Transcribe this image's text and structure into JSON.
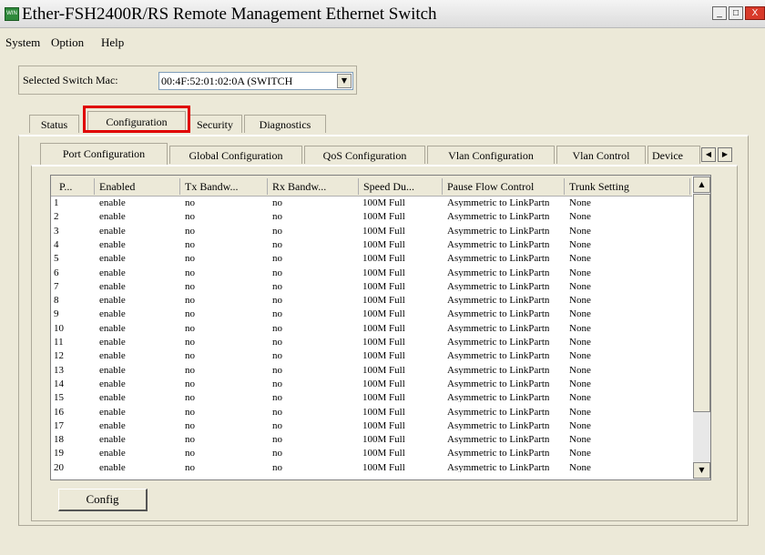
{
  "window": {
    "title": "Ether-FSH2400R/RS Remote Management Ethernet Switch",
    "icon_text": "WIN",
    "minimize": "_",
    "maximize": "□",
    "close": "X"
  },
  "menu": [
    "System",
    "Option",
    "Help"
  ],
  "switch_select": {
    "label": "Selected Switch Mac:",
    "value": "00:4F:52:01:02:0A (SWITCH",
    "arrow": "▼"
  },
  "main_tabs": [
    "Status",
    "Configuration",
    "Security",
    "Diagnostics"
  ],
  "active_main_tab": "Configuration",
  "sub_tabs": [
    "Port Configuration",
    "Global Configuration",
    "QoS Configuration",
    "Vlan Configuration",
    "Vlan Control",
    "Device"
  ],
  "active_sub_tab": "Port Configuration",
  "tab_scroll": {
    "left": "◀",
    "right": "▶"
  },
  "table": {
    "columns": [
      "P...",
      "Enabled",
      "Tx Bandw...",
      "Rx Bandw...",
      "Speed Du...",
      "Pause Flow Control",
      "Trunk Setting"
    ],
    "rows": [
      [
        "1",
        "enable",
        "no",
        "no",
        "100M Full",
        "Asymmetric to LinkPartn",
        "None"
      ],
      [
        "2",
        "enable",
        "no",
        "no",
        "100M Full",
        "Asymmetric to LinkPartn",
        "None"
      ],
      [
        "3",
        "enable",
        "no",
        "no",
        "100M Full",
        "Asymmetric to LinkPartn",
        "None"
      ],
      [
        "4",
        "enable",
        "no",
        "no",
        "100M Full",
        "Asymmetric to LinkPartn",
        "None"
      ],
      [
        "5",
        "enable",
        "no",
        "no",
        "100M Full",
        "Asymmetric to LinkPartn",
        "None"
      ],
      [
        "6",
        "enable",
        "no",
        "no",
        "100M Full",
        "Asymmetric to LinkPartn",
        "None"
      ],
      [
        "7",
        "enable",
        "no",
        "no",
        "100M Full",
        "Asymmetric to LinkPartn",
        "None"
      ],
      [
        "8",
        "enable",
        "no",
        "no",
        "100M Full",
        "Asymmetric to LinkPartn",
        "None"
      ],
      [
        "9",
        "enable",
        "no",
        "no",
        "100M Full",
        "Asymmetric to LinkPartn",
        "None"
      ],
      [
        "10",
        "enable",
        "no",
        "no",
        "100M Full",
        "Asymmetric to LinkPartn",
        "None"
      ],
      [
        "11",
        "enable",
        "no",
        "no",
        "100M Full",
        "Asymmetric to LinkPartn",
        "None"
      ],
      [
        "12",
        "enable",
        "no",
        "no",
        "100M Full",
        "Asymmetric to LinkPartn",
        "None"
      ],
      [
        "13",
        "enable",
        "no",
        "no",
        "100M Full",
        "Asymmetric to LinkPartn",
        "None"
      ],
      [
        "14",
        "enable",
        "no",
        "no",
        "100M Full",
        "Asymmetric to LinkPartn",
        "None"
      ],
      [
        "15",
        "enable",
        "no",
        "no",
        "100M Full",
        "Asymmetric to LinkPartn",
        "None"
      ],
      [
        "16",
        "enable",
        "no",
        "no",
        "100M Full",
        "Asymmetric to LinkPartn",
        "None"
      ],
      [
        "17",
        "enable",
        "no",
        "no",
        "100M Full",
        "Asymmetric to LinkPartn",
        "None"
      ],
      [
        "18",
        "enable",
        "no",
        "no",
        "100M Full",
        "Asymmetric to LinkPartn",
        "None"
      ],
      [
        "19",
        "enable",
        "no",
        "no",
        "100M Full",
        "Asymmetric to LinkPartn",
        "None"
      ],
      [
        "20",
        "enable",
        "no",
        "no",
        "100M Full",
        "Asymmetric to LinkPartn",
        "None"
      ]
    ]
  },
  "scrollbar": {
    "up": "▲",
    "down": "▼"
  },
  "config_button": "Config",
  "colors": {
    "highlight": "#e00000",
    "window_bg": "#ece9d8"
  }
}
